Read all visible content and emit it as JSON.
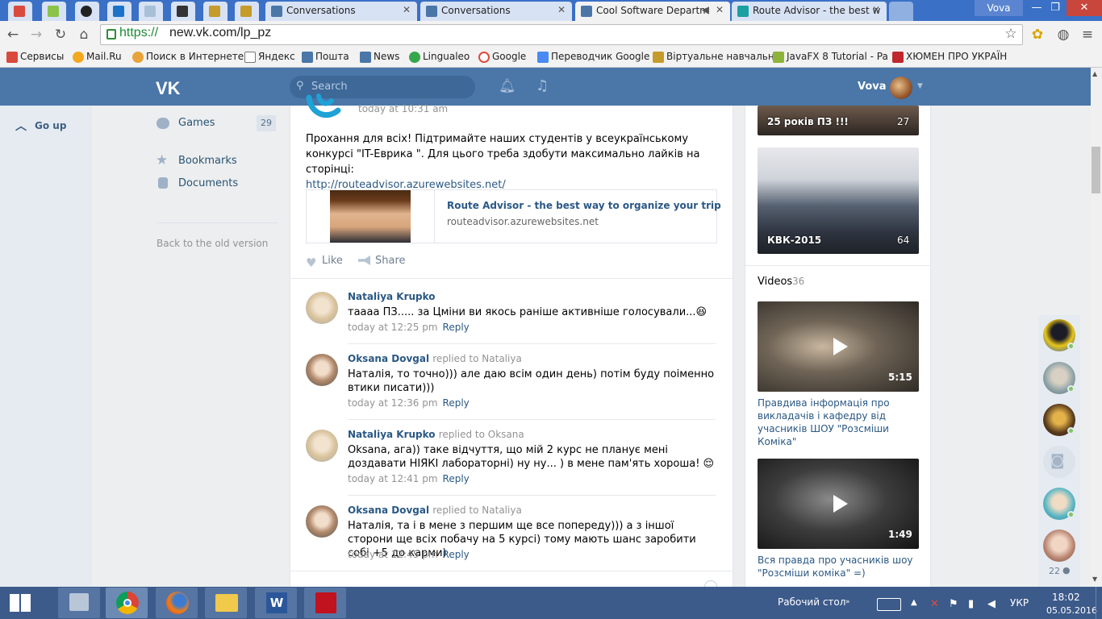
{
  "browser": {
    "tabs": [
      {
        "label": "Conversations"
      },
      {
        "label": "Conversations"
      },
      {
        "label": "Cool Software Departm"
      },
      {
        "label": "Route Advisor - the best w"
      }
    ],
    "window_user": "Vova",
    "url_scheme": "https://",
    "url_host": "new.vk.com/lp_pz",
    "bookmarks": [
      {
        "label": "Сервисы",
        "color": "#d94a3d"
      },
      {
        "label": "Mail.Ru",
        "color": "#f4a81d"
      },
      {
        "label": "Поиск в Интернете",
        "color": "#e8a43a"
      },
      {
        "label": "Яндекс",
        "color": "#ffffff"
      },
      {
        "label": "Пошта",
        "color": "#4a76a8"
      },
      {
        "label": "News",
        "color": "#4a76a8"
      },
      {
        "label": "Lingualeo",
        "color": "#35a84b"
      },
      {
        "label": "Google",
        "color": "#ffffff"
      },
      {
        "label": "Переводчик Google",
        "color": "#4a8af4"
      },
      {
        "label": "Віртуальне навчальн",
        "color": "#c59b2b"
      },
      {
        "label": "JavaFX 8 Tutorial - Pa",
        "color": "#8eb33b"
      },
      {
        "label": "ХЮМЕН ПРО УКРАЇН",
        "color": "#c0272d"
      }
    ]
  },
  "vk": {
    "logo": "VK",
    "search_placeholder": "Search",
    "user_name": "Vova",
    "go_up": "Go up",
    "nav": {
      "games": "Games",
      "games_count": "29",
      "bookmarks": "Bookmarks",
      "documents": "Documents",
      "old_version": "Back to the old version"
    },
    "post": {
      "time": "today at 10:31 am",
      "text": "Прохання для всіх! Підтримайте наших студентів у всеукраїнському конкурсі \"IT-Еврика \". Для цього треба здобути максимально лайків на сторінці:",
      "link": "http://routeadvisor.azurewebsites.net/",
      "snippet_title": "Route Advisor - the best way to organize your trip",
      "snippet_host": "routeadvisor.azurewebsites.net",
      "like_label": "Like",
      "share_label": "Share"
    },
    "comments": [
      {
        "name": "Nataliya Krupko",
        "replied": "",
        "text": "тааaa ПЗ..... за Цміни ви якось раніше активніше голосували...😆",
        "time": "today at 12:25 pm",
        "reply": "Reply"
      },
      {
        "name": "Oksana Dovgal",
        "replied": "replied to Nataliya",
        "text": "Наталія, то точно))) але даю всім один день) потім буду поіменно втики писати)))",
        "time": "today at 12:36 pm",
        "reply": "Reply"
      },
      {
        "name": "Nataliya Krupko",
        "replied": "replied to Oksana",
        "text": "Oksana, ага)) таке відчуття, що мій 2 курс не планує мені доздавати НІЯКІ лабораторні) ну ну... ) в мене пам'ять хороша! 😌",
        "time": "today at 12:41 pm",
        "reply": "Reply"
      },
      {
        "name": "Oksana Dovgal",
        "replied": "replied to Nataliya",
        "text": "Наталія, та і в мене з першим ще все попереду))) а з іншої сторони ще всіх побачу на 5 курсі) тому мають шанс заробити собі +5 до карми)",
        "time": "today at 12:45 pm",
        "reply": "Reply"
      }
    ],
    "albums": [
      {
        "title": "25 років ПЗ !!!",
        "count": "27"
      },
      {
        "title": "КВК-2015",
        "count": "64"
      }
    ],
    "videos_title": "Videos",
    "videos_count": "36",
    "videos": [
      {
        "duration": "5:15",
        "title": "Правдива інформація про викладачів і кафедру від учасників ШОУ \"Розсміши Коміка\""
      },
      {
        "duration": "1:49",
        "title": "Вся правда про учасників шоу \"Розсміши коміка\" =)"
      }
    ],
    "chat_count": "22"
  },
  "taskbar": {
    "desktop_label": "Рабочий стол",
    "lang": "УКР",
    "time": "18:02",
    "date": "05.05.2016"
  },
  "colors": {
    "vk_blue": "#4a76a8",
    "link": "#2a5885",
    "chrome_frame": "#3a70c6"
  }
}
